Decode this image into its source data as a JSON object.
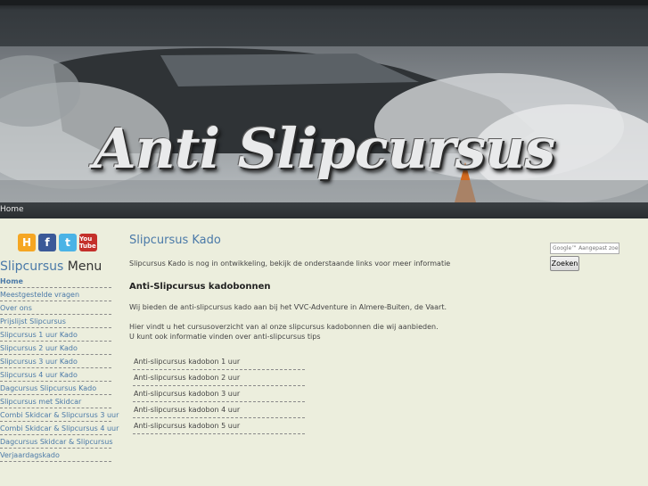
{
  "banner": {
    "title": "Anti Slipcursus"
  },
  "nav": {
    "home": "Home"
  },
  "social": {
    "hyves": "H",
    "facebook": "f",
    "twitter": "t",
    "youtube": "You Tube"
  },
  "sidebar": {
    "title_highlight": "Slipcursus",
    "title_rest": " Menu",
    "items": [
      "Home",
      "Meestgestelde vragen",
      "Over ons",
      "Prijslijst Slipcursus",
      "Slipcursus 1 uur Kado",
      "Slipcursus 2 uur Kado",
      "Slipcursus 3 uur Kado",
      "Slipcursus 4 uur Kado",
      "Dagcursus Slipcursus Kado",
      "Slipcursus met Skidcar",
      "Combi Skidcar & Slipcursus 3 uur",
      "Combi Skidcar & Slipcursus 4 uur",
      "Dagcursus Skidcar & Slipcursus",
      "Verjaardagskado"
    ]
  },
  "main": {
    "title": "Slipcursus Kado",
    "intro": "Slipcursus Kado is nog in ontwikkeling, bekijk de onderstaande links voor meer informatie",
    "subtitle": "Anti-Slipcursus kadobonnen",
    "p1": "Wij bieden de anti-slipcursus kado aan bij het VVC-Adventure in Almere-Buiten, de Vaart.",
    "p2_line1": "Hier vindt u het cursusoverzicht van al onze slipcursus kadobonnen die wij aanbieden.",
    "p2_line2": "U kunt ook informatie vinden over anti-slipcursus tips",
    "links": [
      "Anti-slipcursus kadobon 1 uur",
      "Anti-slipcursus kadobon 2 uur",
      "Anti-slipcursus kadobon 3 uur",
      "Anti-slipcursus kadobon 4 uur",
      "Anti-slipcursus kadobon 5 uur"
    ]
  },
  "search": {
    "placeholder": "Google™ Aangepast zoeken",
    "button": "Zoeken"
  }
}
